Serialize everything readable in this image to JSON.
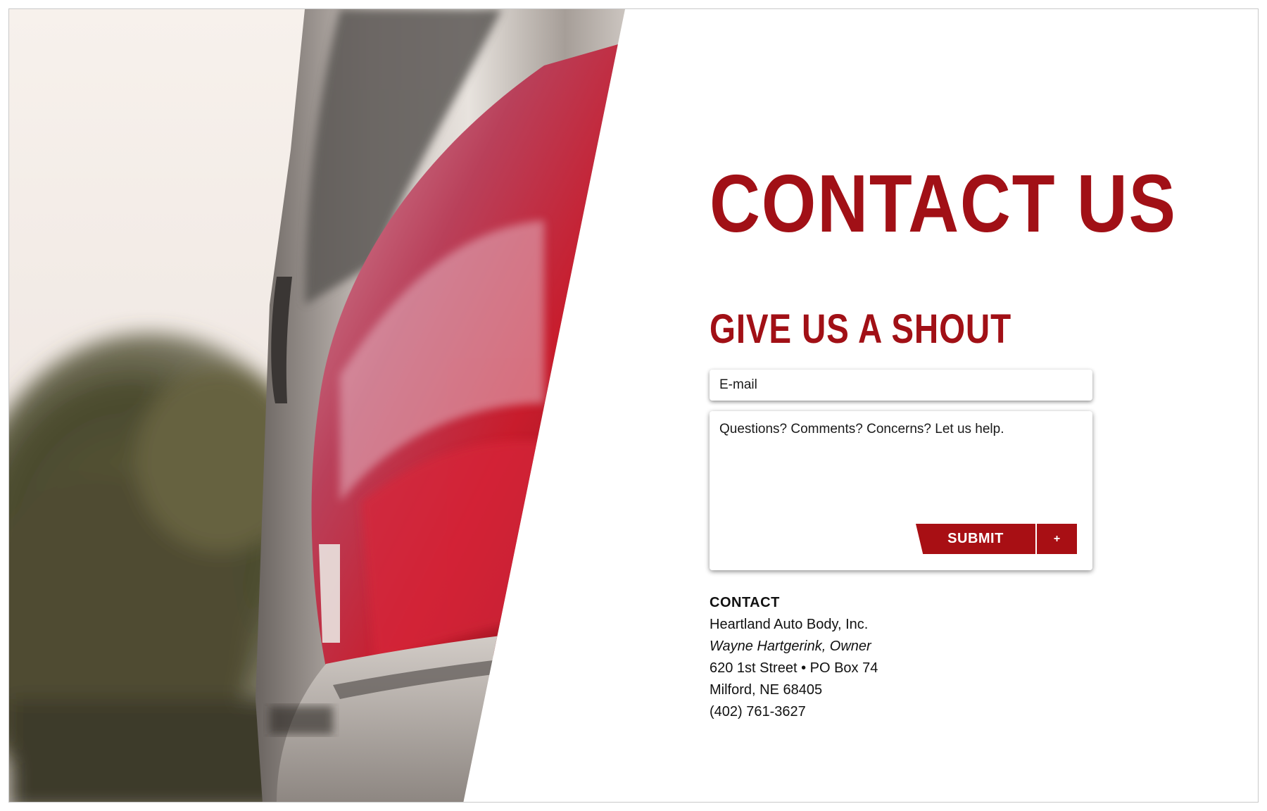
{
  "page": {
    "title": "CONTACT US",
    "subtitle": "GIVE US A SHOUT"
  },
  "form": {
    "email_placeholder": "E-mail",
    "message_placeholder": "Questions? Comments? Concerns? Let us help.",
    "submit_label": "SUBMIT",
    "plus_label": "+"
  },
  "contact": {
    "heading": "CONTACT",
    "company": "Heartland Auto Body, Inc.",
    "owner": "Wayne Hartgerink, Owner",
    "address": "620 1st Street • PO Box 74",
    "city": "Milford, NE 68405",
    "phone": "(402) 761-3627"
  },
  "colors": {
    "brand_red": "#a11016",
    "button_red": "#a80f14",
    "text": "#111111",
    "background": "#ffffff"
  },
  "hero_image": {
    "subject": "car-tail-light-photo"
  }
}
